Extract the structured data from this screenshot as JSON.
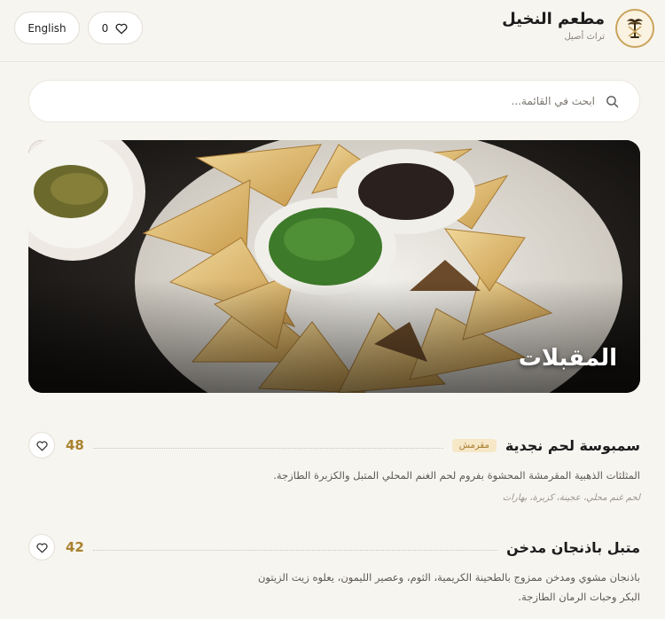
{
  "header": {
    "language_label": "English",
    "favorites_count": "0",
    "restaurant_name": "مطعم النخيل",
    "tagline": "تراث أصيل"
  },
  "search": {
    "placeholder": "ابحث في القائمة...",
    "value": ""
  },
  "category": {
    "title": "المقبلات"
  },
  "items": [
    {
      "name": "سمبوسة لحم نجدية",
      "badge": "مقرمش",
      "price": "48",
      "description": "المثلثات الذهبية المقرمشة المحشوة بفروم لحم الغنم المحلي المتبل والكزبرة الطازجة.",
      "ingredients": "لحم غنم محلي، عجينة، كزبرة، بهارات"
    },
    {
      "name": "متبل باذنجان مدخن",
      "price": "42",
      "description_line1": "باذنجان مشوي ومدخن ممزوج بالطحينة الكريمية، الثوم، وعصير الليمون، يعلوه زيت الزيتون",
      "description_line2": "البكر وحبات الرمان الطازجة."
    }
  ],
  "colors": {
    "accent": "#a9822f",
    "badge_bg": "#f6e7c7",
    "background": "#f7f5f0"
  },
  "icons": {
    "favorites": "heart-icon",
    "search": "search-icon",
    "like": "heart-icon",
    "logo": "palm-crossed-utensils-icon"
  }
}
